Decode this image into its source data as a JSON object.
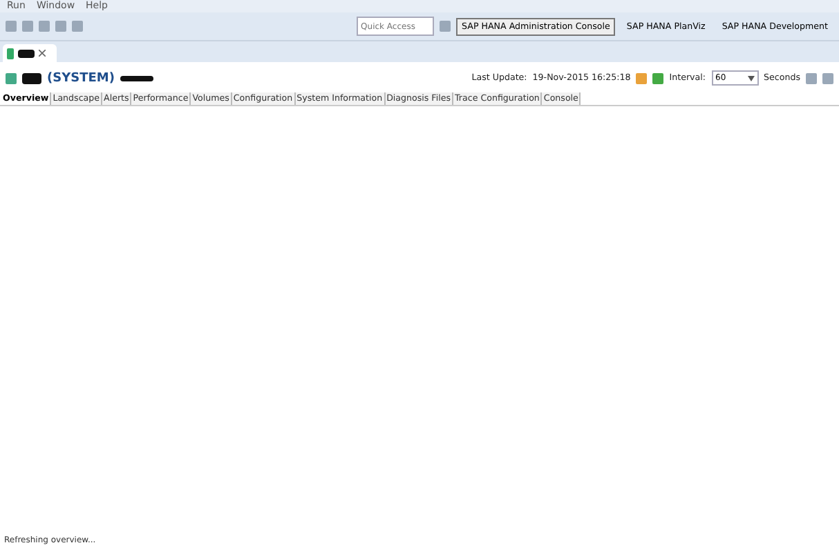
{
  "menu": [
    "Run",
    "Window",
    "Help"
  ],
  "toolbar": {
    "quick_access": {
      "placeholder": "Quick Access"
    },
    "perspectives": [
      {
        "label": "SAP HANA Administration Console",
        "selected": true
      },
      {
        "label": "SAP HANA PlanViz",
        "selected": false
      },
      {
        "label": "SAP HANA Development",
        "selected": false
      }
    ]
  },
  "header": {
    "system": "(SYSTEM)",
    "last_update_label": "Last Update:",
    "last_update": "19-Nov-2015 16:25:18",
    "interval_label": "Interval:",
    "interval": "60",
    "seconds": "Seconds"
  },
  "tabs": [
    {
      "label": "Overview",
      "selected": true
    },
    {
      "label": "Landscape",
      "selected": false
    },
    {
      "label": "Alerts",
      "selected": false
    },
    {
      "label": "Performance",
      "selected": false
    },
    {
      "label": "Volumes",
      "selected": false
    },
    {
      "label": "Configuration",
      "selected": false
    },
    {
      "label": "System Information",
      "selected": false
    },
    {
      "label": "Diagnosis Files",
      "selected": false
    },
    {
      "label": "Trace Configuration",
      "selected": false
    },
    {
      "label": "Console",
      "selected": false
    }
  ],
  "status_bar": "Refreshing overview..."
}
